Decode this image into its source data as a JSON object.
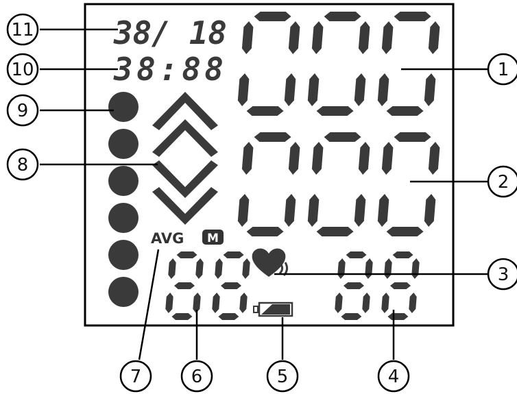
{
  "display": {
    "date_text": "38/ 18",
    "time_text": "38:88",
    "systolic_value": "000",
    "diastolic_value": "000",
    "pulse_value": "88",
    "memory_value": "88",
    "avg_label": "AVG",
    "memory_badge": "M",
    "who_indicator_count": 6
  },
  "callouts": [
    {
      "number": "1",
      "part": "systolic-value"
    },
    {
      "number": "2",
      "part": "diastolic-value"
    },
    {
      "number": "3",
      "part": "heart-icon"
    },
    {
      "number": "4",
      "part": "pulse-value"
    },
    {
      "number": "5",
      "part": "battery-icon"
    },
    {
      "number": "6",
      "part": "memory-value"
    },
    {
      "number": "7",
      "part": "avg-label"
    },
    {
      "number": "8",
      "part": "arrow-icons"
    },
    {
      "number": "9",
      "part": "who-indicators"
    },
    {
      "number": "10",
      "part": "time-display"
    },
    {
      "number": "11",
      "part": "date-display"
    }
  ],
  "colors": {
    "segment": "#3a3a3a",
    "frame": "#000000",
    "leader": "#000000"
  }
}
